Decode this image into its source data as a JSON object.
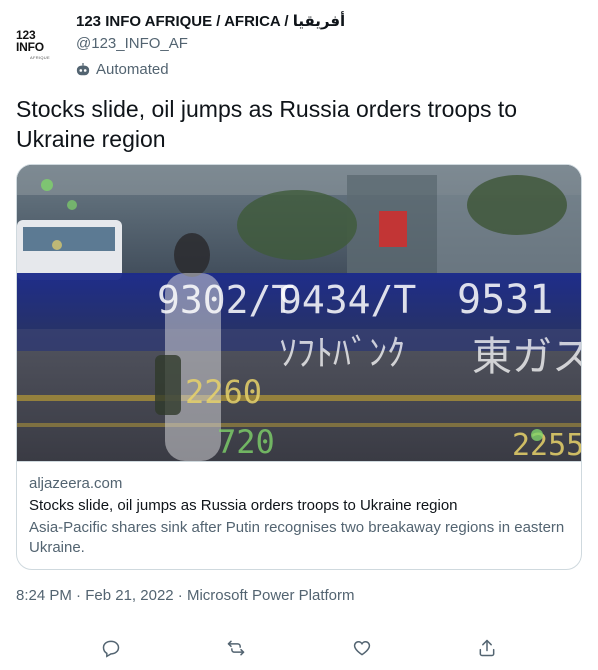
{
  "account": {
    "avatar_text": "123 INFO",
    "avatar_subtext": "AFRIQUE",
    "display_name": "123 INFO AFRIQUE / AFRICA / أفريقيا",
    "handle": "@123_INFO_AF",
    "automated_label": "Automated"
  },
  "tweet": {
    "text": "Stocks slide, oil jumps as Russia orders troops to Ukraine region"
  },
  "card": {
    "domain": "aljazeera.com",
    "title": "Stocks slide, oil jumps as Russia orders troops to Ukraine region",
    "description": "Asia-Pacific shares sink after Putin recognises two breakaway regions in eastern Ukraine.",
    "ticker_numbers": [
      "9302/T",
      "9434/T",
      "9531",
      "2260",
      "720",
      "2255"
    ],
    "ticker_words": [
      "ｿﾌﾄﾊﾞﾝｸ",
      "東ガス"
    ]
  },
  "meta": {
    "time": "8:24 PM",
    "separator": "·",
    "date": "Feb 21, 2022",
    "source": "Microsoft Power Platform"
  },
  "colors": {
    "text": "#0f1419",
    "secondary": "#536471",
    "border": "#cfd9de"
  },
  "icons": {
    "reply": "reply-icon",
    "retweet": "retweet-icon",
    "like": "like-icon",
    "share": "share-icon",
    "bot": "bot-icon"
  }
}
